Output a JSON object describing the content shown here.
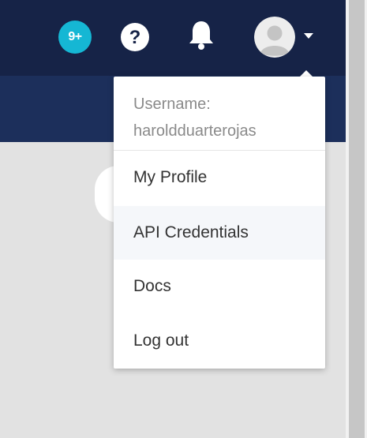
{
  "header": {
    "notifications_badge": "9+",
    "icons": {
      "badge": "notification-count-badge",
      "help": "help-circle-icon",
      "bell": "bell-icon",
      "avatar": "user-avatar",
      "caret": "caret-down-icon"
    }
  },
  "user_menu": {
    "username_label": "Username:",
    "username": "haroldduarterojas",
    "items": [
      {
        "label": "My Profile"
      },
      {
        "label": "API Credentials"
      },
      {
        "label": "Docs"
      },
      {
        "label": "Log out"
      }
    ],
    "highlighted_item": "API Credentials"
  },
  "colors": {
    "topbar": "#162347",
    "subbar": "#1c2f5b",
    "badge": "#15b7d4",
    "background": "#e2e2e2"
  }
}
